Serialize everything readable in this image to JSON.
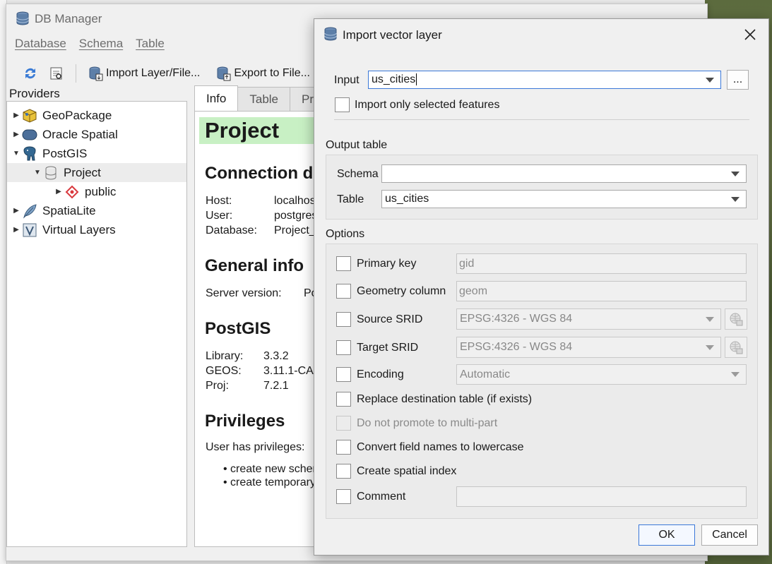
{
  "dbmanager": {
    "title": "DB Manager",
    "menu": [
      "Database",
      "Schema",
      "Table"
    ],
    "toolbar": {
      "import_label": "Import Layer/File...",
      "export_label": "Export to File..."
    },
    "providers_label": "Providers",
    "tree": [
      {
        "label": "GeoPackage",
        "icon": "geopackage-icon",
        "expanded": false
      },
      {
        "label": "Oracle Spatial",
        "icon": "database-icon",
        "expanded": false
      },
      {
        "label": "PostGIS",
        "icon": "elephant-icon",
        "expanded": true
      },
      {
        "label": "Project",
        "icon": "database-icon",
        "expanded": true,
        "selected": true
      },
      {
        "label": "public",
        "icon": "schema-icon",
        "expanded": false
      },
      {
        "label": "SpatiaLite",
        "icon": "feather-icon",
        "expanded": false
      },
      {
        "label": "Virtual Layers",
        "icon": "virtual-layer-icon",
        "expanded": false
      }
    ],
    "tabs": [
      "Info",
      "Table",
      "Pr"
    ],
    "info": {
      "title": "Project",
      "connection_heading": "Connection d",
      "connection": [
        {
          "key": "Host:",
          "value": "localhos"
        },
        {
          "key": "User:",
          "value": "postgres"
        },
        {
          "key": "Database:",
          "value": "Project_"
        }
      ],
      "general_heading": "General info",
      "server_version_key": "Server version:",
      "server_version_value": "Po",
      "postgis_heading": "PostGIS",
      "postgis": [
        {
          "key": "Library:",
          "value": "3.3.2"
        },
        {
          "key": "GEOS:",
          "value": "3.11.1-CA"
        },
        {
          "key": "Proj:",
          "value": "7.2.1"
        }
      ],
      "privileges_heading": "Privileges",
      "privileges_text": "User has privileges:",
      "privileges": [
        "create new scher",
        "create temporary"
      ]
    }
  },
  "dialog": {
    "title": "Import vector layer",
    "input_label": "Input",
    "input_value": "us_cities",
    "browse_label": "...",
    "only_selected_label": "Import only selected features",
    "output_table_label": "Output table",
    "schema_label": "Schema",
    "schema_value": "",
    "table_label": "Table",
    "table_value": "us_cities",
    "options_label": "Options",
    "primary_key_label": "Primary key",
    "primary_key_value": "gid",
    "geometry_column_label": "Geometry column",
    "geometry_column_value": "geom",
    "source_srid_label": "Source SRID",
    "source_srid_value": "EPSG:4326 - WGS 84",
    "target_srid_label": "Target SRID",
    "target_srid_value": "EPSG:4326 - WGS 84",
    "encoding_label": "Encoding",
    "encoding_value": "Automatic",
    "replace_label": "Replace destination table (if exists)",
    "no_promote_label": "Do not promote to multi-part",
    "lowercase_label": "Convert field names to lowercase",
    "spatial_index_label": "Create spatial index",
    "comment_label": "Comment",
    "comment_value": "",
    "ok_label": "OK",
    "cancel_label": "Cancel"
  }
}
